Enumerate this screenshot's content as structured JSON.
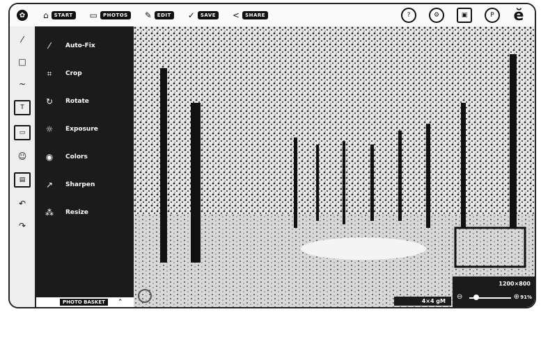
{
  "topnav": [
    {
      "icon": "⌂",
      "label": "START"
    },
    {
      "icon": "▭",
      "label": "PHOTOS"
    },
    {
      "icon": "✎",
      "label": "EDIT"
    },
    {
      "icon": "✓",
      "label": "SAVE"
    },
    {
      "icon": "<",
      "label": "SHARE"
    }
  ],
  "tools": [
    {
      "icon": "⁄",
      "label": "Auto-Fix"
    },
    {
      "icon": "⌗",
      "label": "Crop"
    },
    {
      "icon": "↻",
      "label": "Rotate"
    },
    {
      "icon": "☼",
      "label": "Exposure"
    },
    {
      "icon": "◉",
      "label": "Colors"
    },
    {
      "icon": "↗",
      "label": "Sharpen"
    },
    {
      "icon": "⁂",
      "label": "Resize"
    }
  ],
  "basket_label": "PHOTO BASKET",
  "image_dims": "1200×800",
  "zoom_percent": "91%",
  "zoom_fraction": 0.1,
  "photo_tag": "4×4 gM"
}
